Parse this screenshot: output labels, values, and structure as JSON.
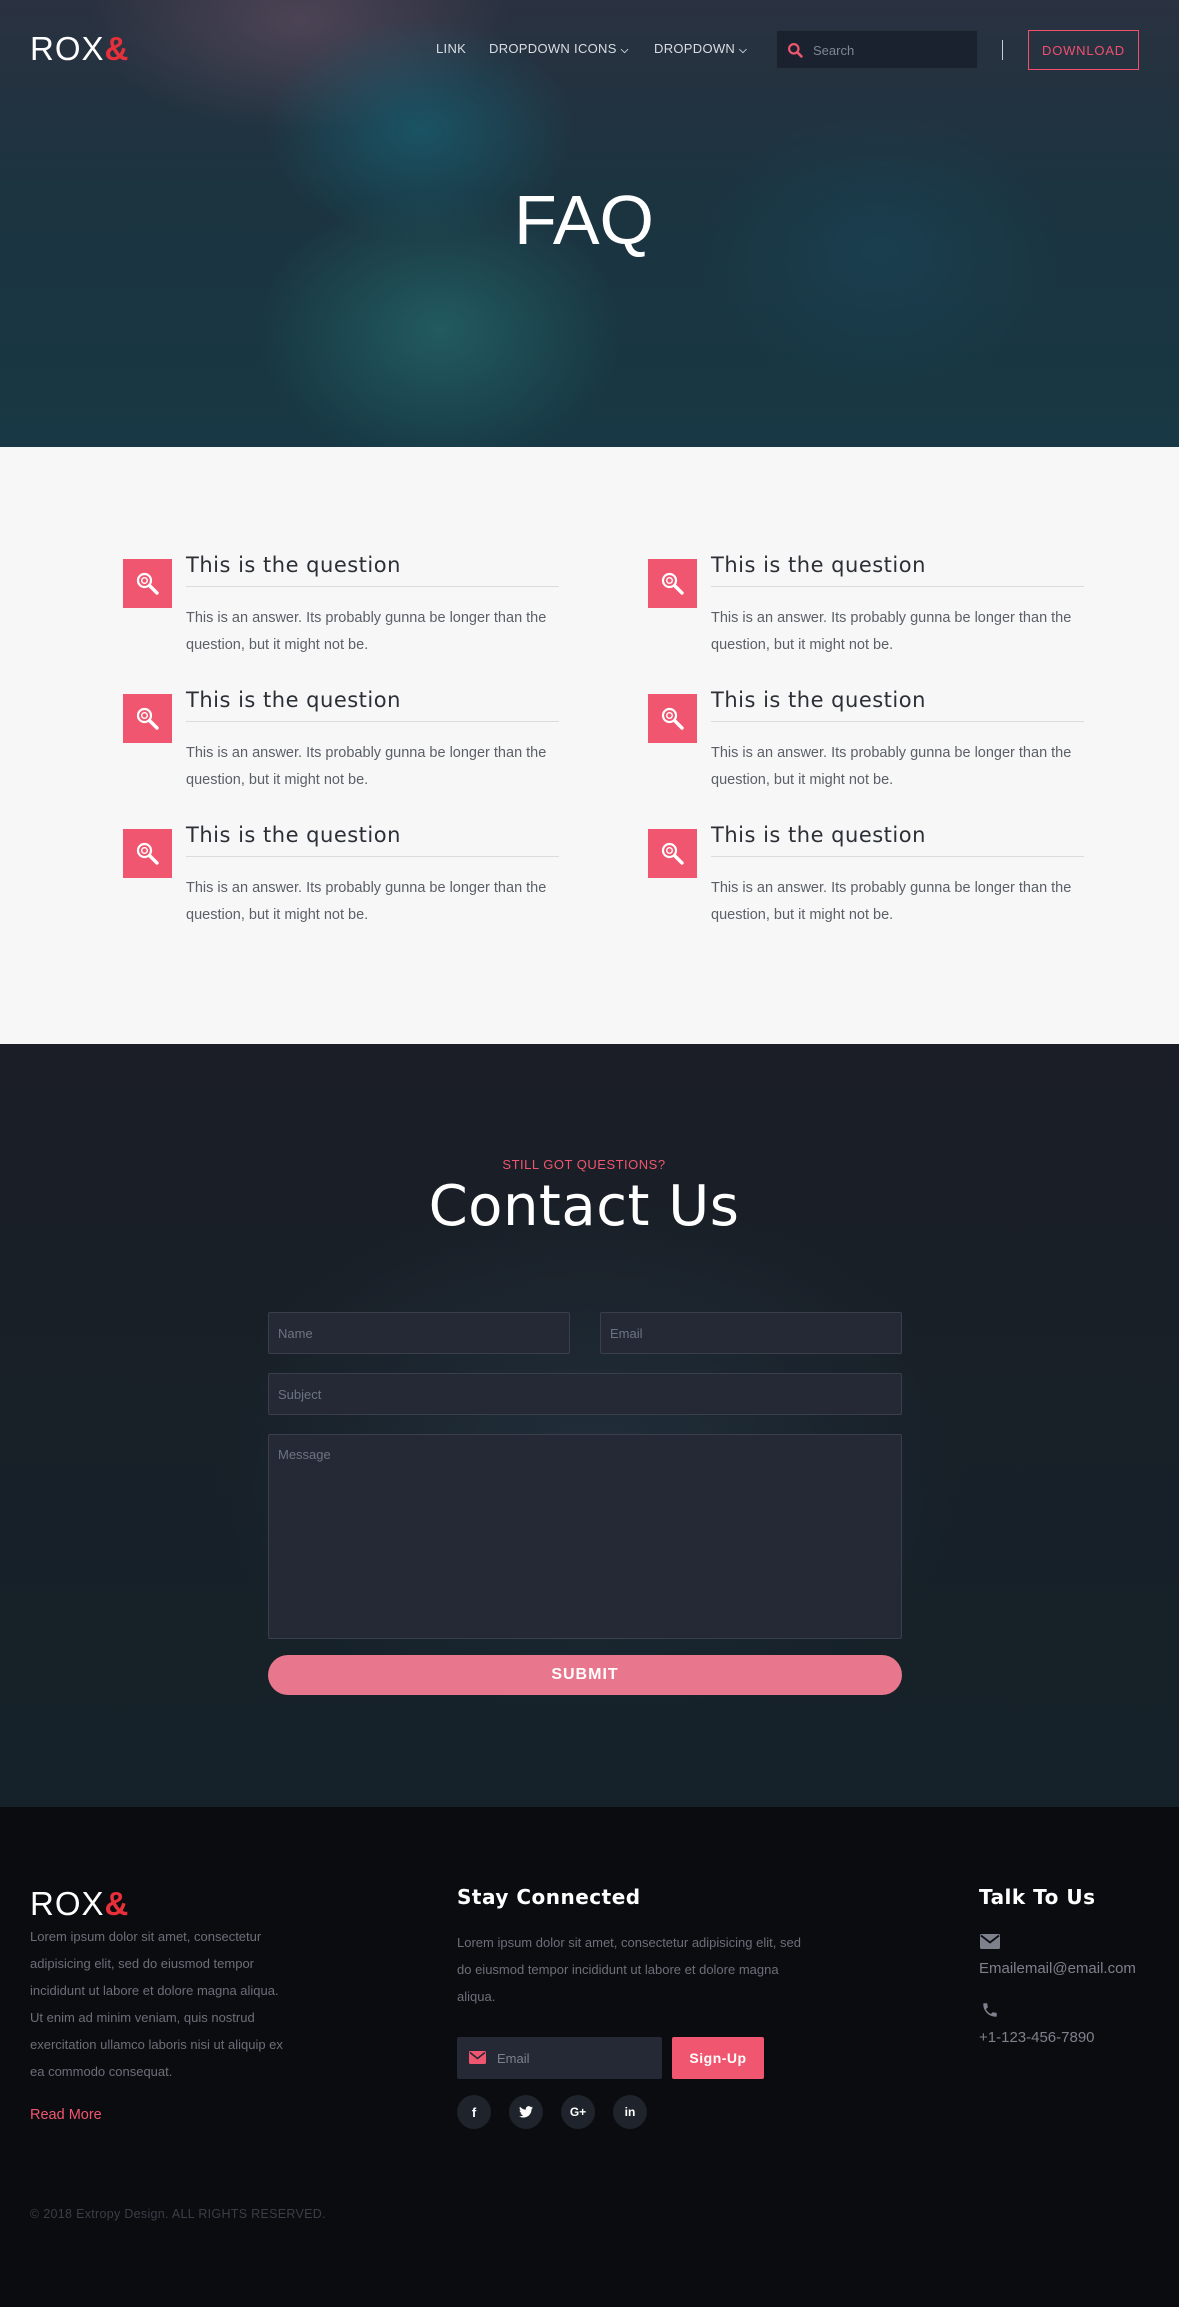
{
  "header": {
    "logo_text": "ROX",
    "logo_amp": "&",
    "nav": [
      {
        "label": "LINK"
      },
      {
        "label": "DROPDOWN ICONS"
      },
      {
        "label": "DROPDOWN"
      }
    ],
    "search_placeholder": "Search",
    "download_label": "DOWNLOAD"
  },
  "hero": {
    "title": "FAQ"
  },
  "faq": {
    "items": [
      {
        "question": "This is the question",
        "answer": "This is an answer. Its probably gunna be longer than the question, but it might not be."
      },
      {
        "question": "This is the question",
        "answer": "This is an answer. Its probably gunna be longer than the question, but it might not be."
      },
      {
        "question": "This is the question",
        "answer": "This is an answer. Its probably gunna be longer than the question, but it might not be."
      },
      {
        "question": "This is the question",
        "answer": "This is an answer. Its probably gunna be longer than the question, but it might not be."
      },
      {
        "question": "This is the question",
        "answer": "This is an answer. Its probably gunna be longer than the question, but it might not be."
      },
      {
        "question": "This is the question",
        "answer": "This is an answer. Its probably gunna be longer than the question, but it might not be."
      }
    ],
    "icon": "search-icon"
  },
  "contact": {
    "eyebrow": "STILL GOT QUESTIONS?",
    "title": "Contact Us",
    "name_placeholder": "Name",
    "email_placeholder": "Email",
    "subject_placeholder": "Subject",
    "message_placeholder": "Message",
    "submit_label": "SUBMIT"
  },
  "footer": {
    "logo_text": "ROX",
    "logo_amp": "&",
    "about": "Lorem ipsum dolor sit amet, consectetur adipisicing elit, sed do eiusmod tempor incididunt ut labore et dolore magna aliqua. Ut enim ad minim veniam, quis nostrud exercitation ullamco laboris nisi ut aliquip ex ea commodo consequat.",
    "read_more": "Read More",
    "stay_connected_heading": "Stay Connected",
    "stay_connected_text": "Lorem ipsum dolor sit amet, consectetur adipisicing elit, sed do eiusmod tempor incididunt ut labore et dolore magna aliqua.",
    "newsletter_placeholder": "Email",
    "signup_label": "Sign-Up",
    "social": [
      {
        "icon": "facebook-icon",
        "glyph": "f"
      },
      {
        "icon": "twitter-icon",
        "glyph": "t"
      },
      {
        "icon": "google-plus-icon",
        "glyph": "G+"
      },
      {
        "icon": "linkedin-icon",
        "glyph": "in"
      }
    ],
    "talk_heading": "Talk To Us",
    "email": "Emailemail@email.com",
    "phone": "+1-123-456-7890",
    "copyright": "© 2018 Extropy Design. ALL RIGHTS RESERVED."
  },
  "colors": {
    "accent": "#f0566f",
    "logo_amp": "#e8303a",
    "submit": "#e8778d",
    "faq_bg": "#f7f7f7",
    "footer_bg": "#0b0c10"
  }
}
